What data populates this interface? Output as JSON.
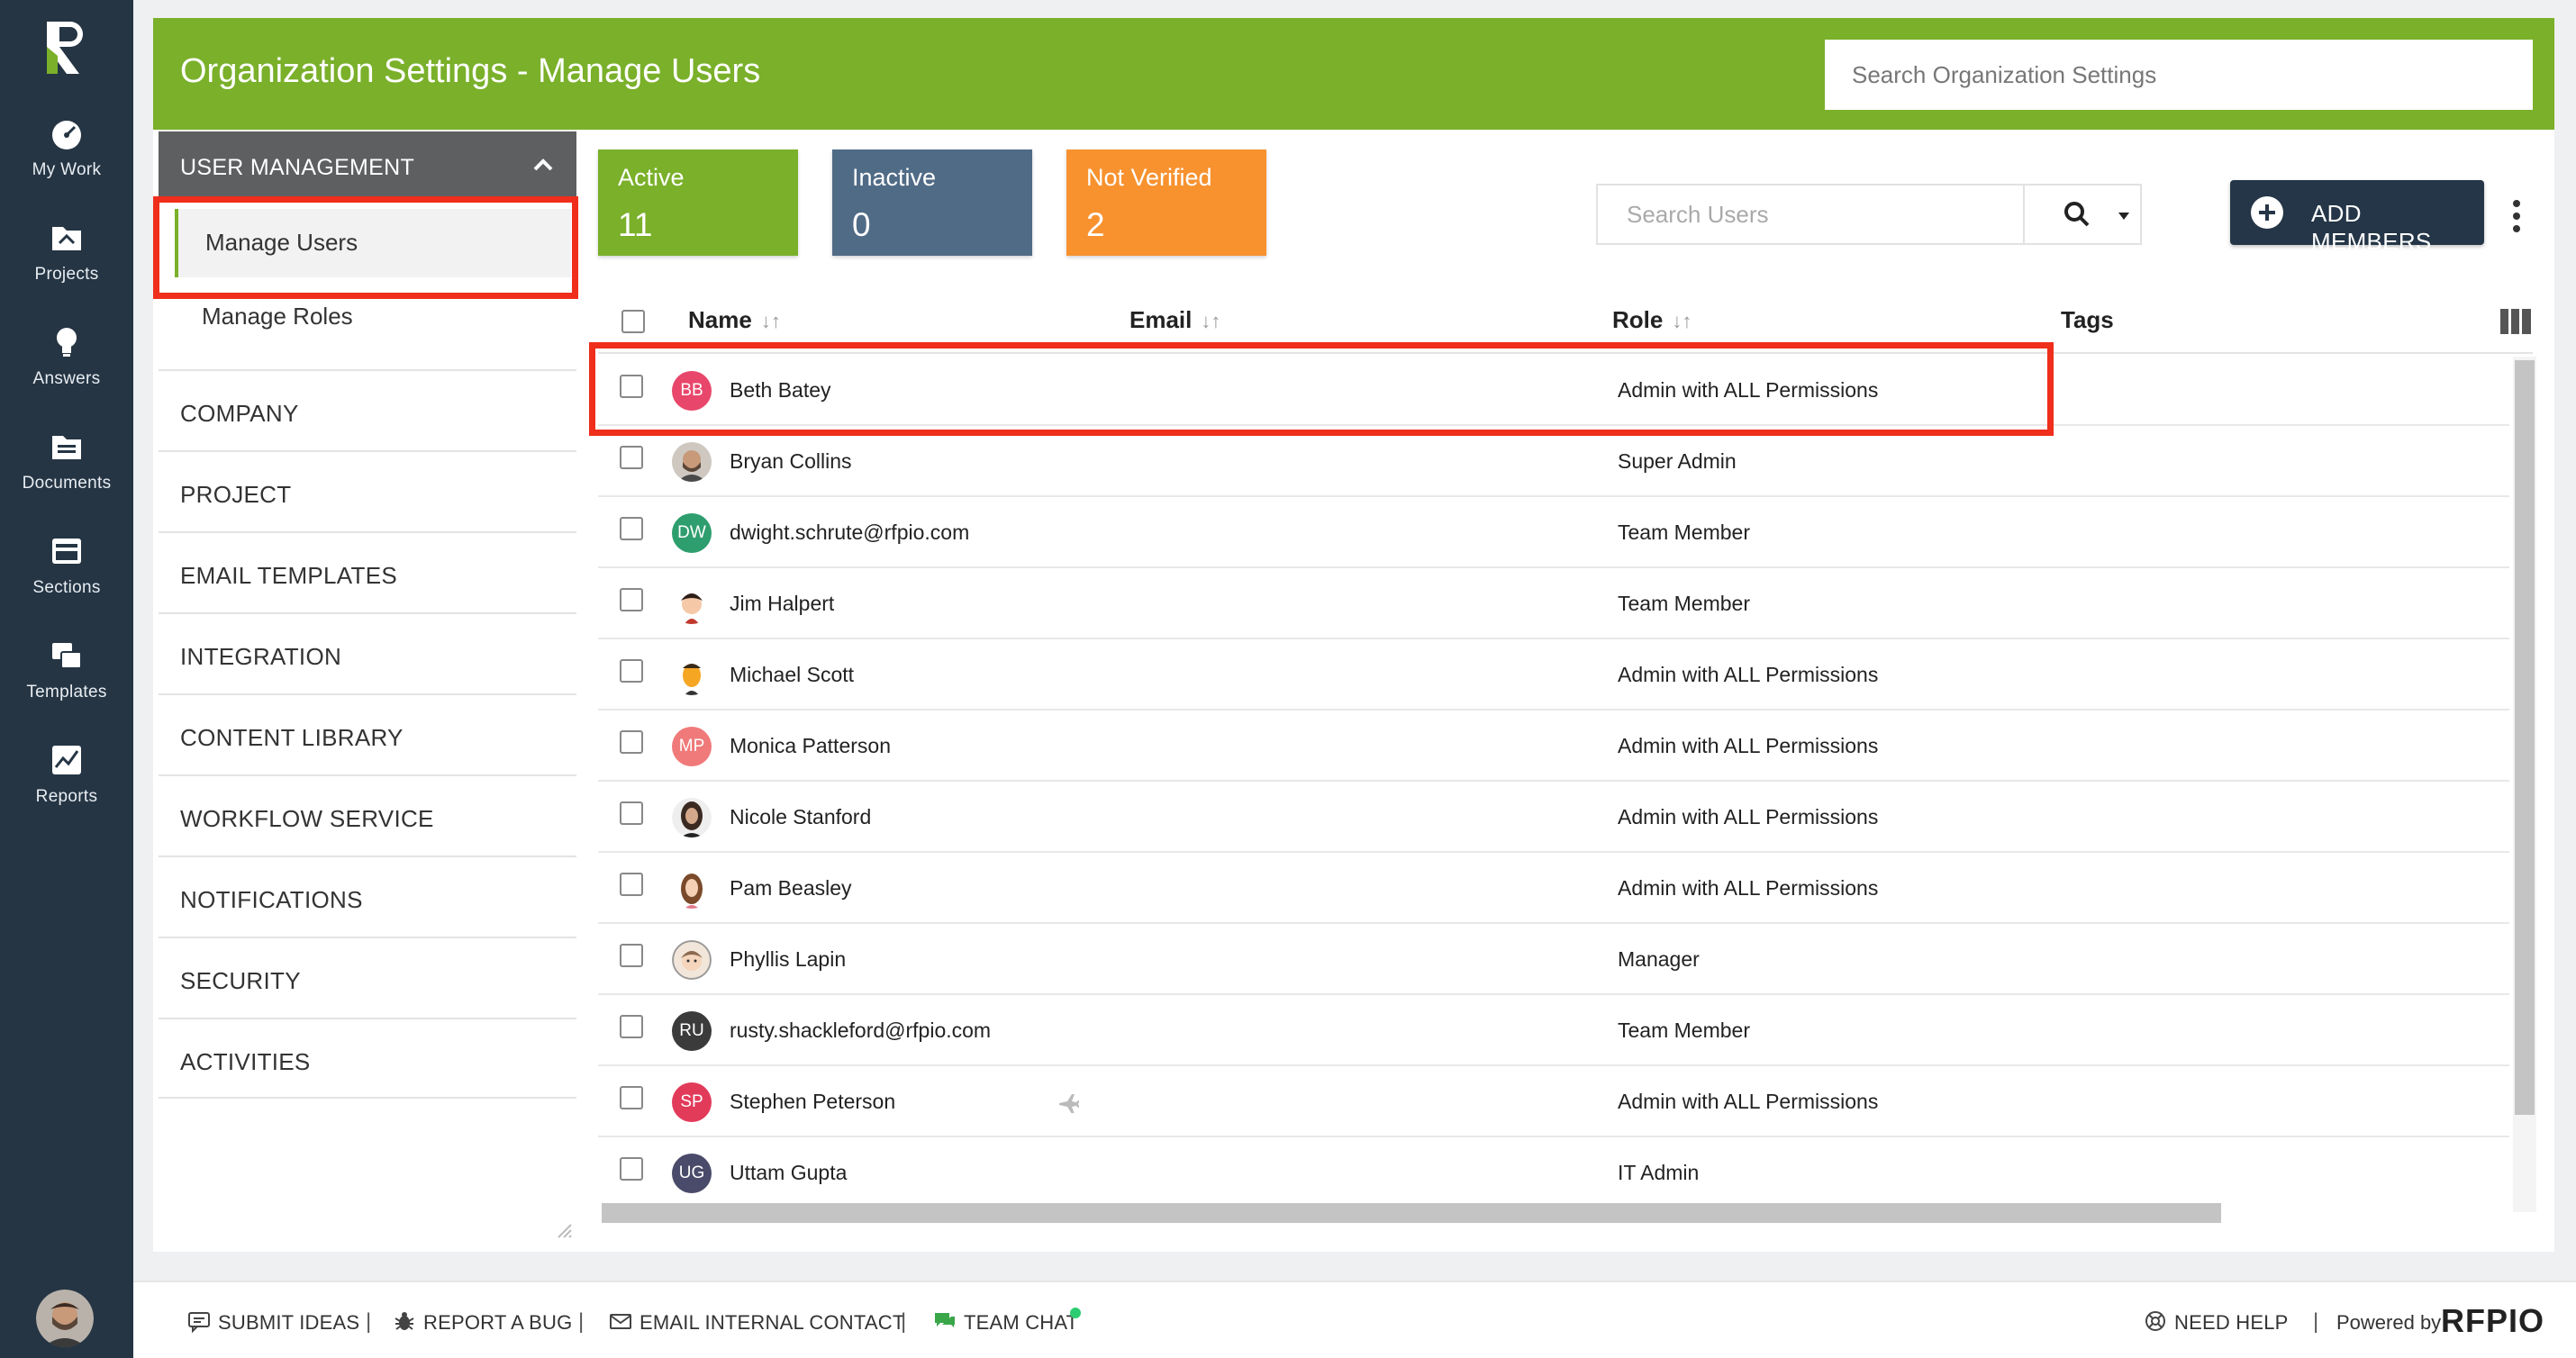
{
  "nav": {
    "items": [
      {
        "label": "My Work",
        "icon": "gauge-icon"
      },
      {
        "label": "Projects",
        "icon": "projects-icon"
      },
      {
        "label": "Answers",
        "icon": "lightbulb-icon"
      },
      {
        "label": "Documents",
        "icon": "documents-icon"
      },
      {
        "label": "Sections",
        "icon": "sections-icon"
      },
      {
        "label": "Templates",
        "icon": "templates-icon"
      },
      {
        "label": "Reports",
        "icon": "reports-icon"
      }
    ]
  },
  "header": {
    "title": "Organization Settings - Manage Users",
    "search_placeholder": "Search Organization Settings"
  },
  "sidebar": {
    "group_label": "USER MANAGEMENT",
    "sub_items": [
      {
        "label": "Manage Users",
        "active": true
      },
      {
        "label": "Manage Roles",
        "active": false
      }
    ],
    "sections": [
      "COMPANY",
      "PROJECT",
      "EMAIL TEMPLATES",
      "INTEGRATION",
      "CONTENT LIBRARY",
      "WORKFLOW SERVICE",
      "NOTIFICATIONS",
      "SECURITY",
      "ACTIVITIES"
    ]
  },
  "stats": [
    {
      "label": "Active",
      "value": "11",
      "color": "#7ab02a"
    },
    {
      "label": "Inactive",
      "value": "0",
      "color": "#506b86"
    },
    {
      "label": "Not Verified",
      "value": "2",
      "color": "#f7922f"
    }
  ],
  "toolbar": {
    "search_placeholder": "Search Users",
    "add_label": "ADD MEMBERS"
  },
  "table": {
    "columns": {
      "name": "Name",
      "email": "Email",
      "role": "Role",
      "tags": "Tags"
    },
    "rows": [
      {
        "name": "Beth Batey",
        "initials": "BB",
        "avatar_color": "#e8476b",
        "role": "Admin with ALL Permissions"
      },
      {
        "name": "Bryan Collins",
        "initials": "",
        "avatar_color": "#7a6a5c",
        "role": "Super Admin"
      },
      {
        "name": "dwight.schrute@rfpio.com",
        "initials": "DW",
        "avatar_color": "#2f9e6f",
        "role": "Team Member"
      },
      {
        "name": "Jim Halpert",
        "initials": "",
        "avatar_color": "#f2e2d3",
        "role": "Team Member"
      },
      {
        "name": "Michael Scott",
        "initials": "",
        "avatar_color": "#f5a623",
        "role": "Admin with ALL Permissions"
      },
      {
        "name": "Monica Patterson",
        "initials": "MP",
        "avatar_color": "#f07a7a",
        "role": "Admin with ALL Permissions"
      },
      {
        "name": "Nicole Stanford",
        "initials": "",
        "avatar_color": "#5a4a3f",
        "role": "Admin with ALL Permissions"
      },
      {
        "name": "Pam Beasley",
        "initials": "",
        "avatar_color": "#e9d5c4",
        "role": "Admin with ALL Permissions"
      },
      {
        "name": "Phyllis Lapin",
        "initials": "",
        "avatar_color": "#d8c3ae",
        "role": "Manager"
      },
      {
        "name": "rusty.shackleford@rfpio.com",
        "initials": "RU",
        "avatar_color": "#3b3b3b",
        "role": "Team Member"
      },
      {
        "name": "Stephen Peterson",
        "initials": "SP",
        "avatar_color": "#e23b5a",
        "role": "Admin with ALL Permissions"
      },
      {
        "name": "Uttam Gupta",
        "initials": "UG",
        "avatar_color": "#4a4a6a",
        "role": "IT Admin"
      }
    ]
  },
  "footer": {
    "submit_ideas": "SUBMIT IDEAS",
    "report_bug": "REPORT A BUG",
    "email_contact": "EMAIL INTERNAL CONTACT",
    "team_chat": "TEAM CHAT",
    "need_help": "NEED HELP",
    "powered_by": "Powered by",
    "brand": "RFPIO"
  }
}
